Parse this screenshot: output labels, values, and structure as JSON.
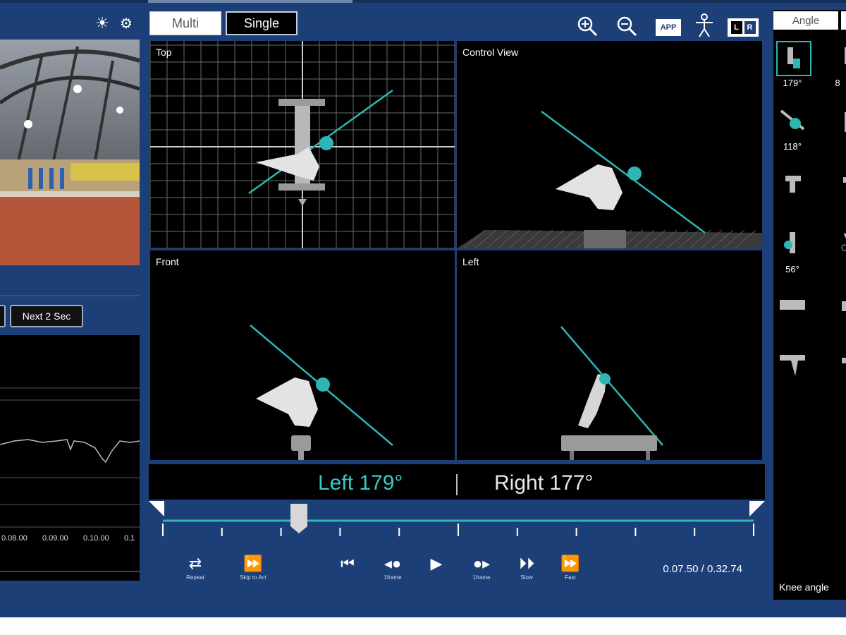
{
  "header": {
    "view_modes": [
      "Multi",
      "Single"
    ],
    "active_view_mode": "Single"
  },
  "toolbar": {
    "zoom_in_icon": "zoom-in-icon",
    "zoom_out_icon": "zoom-out-icon",
    "app_label": "APP",
    "figure_icon": "human-figure-icon",
    "l_label": "L",
    "r_label": "R"
  },
  "left_panel": {
    "next_button": "Next 2 Sec",
    "time_ticks": [
      "0.08.00",
      "0.09.00",
      "0.10.00",
      "0.1"
    ]
  },
  "views": {
    "top": "Top",
    "control": "Control View",
    "front": "Front",
    "left": "Left"
  },
  "readout": {
    "left": "Left 179°",
    "right": "Right 177°"
  },
  "playback": {
    "repeat": "Repeat",
    "skip": "Skip to Act",
    "prev_frame": "1frame",
    "next_frame": "1frame",
    "slow": "Slow",
    "fast": "Fast",
    "time": "0.07.50 / 0.32.74",
    "progress": 0.23
  },
  "right_panel": {
    "tab": "Angle",
    "angles": [
      "179°",
      "118°",
      "56°"
    ],
    "partial_value": "8",
    "footer": "Knee angle"
  },
  "colors": {
    "accent": "#39c9c9",
    "background": "#1d3f78"
  }
}
